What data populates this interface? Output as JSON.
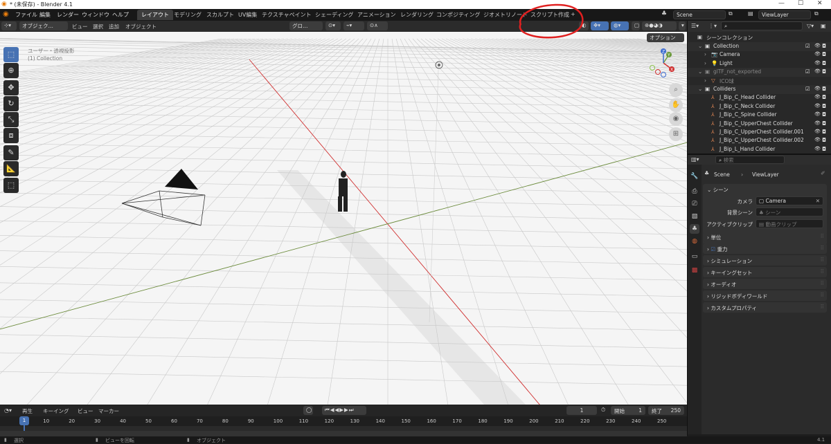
{
  "titlebar": {
    "title": "* (未保存) - Blender 4.1",
    "minimize": "—",
    "maximize": "☐",
    "close": "✕"
  },
  "menu": [
    "ファイル",
    "編集",
    "レンダー",
    "ウィンドウ",
    "ヘルプ"
  ],
  "workspaces": [
    "レイアウト",
    "モデリング",
    "スカルプト",
    "UV編集",
    "テクスチャペイント",
    "シェーディング",
    "アニメーション",
    "レンダリング",
    "コンポジティング",
    "ジオメトリノード",
    "スクリプト作成",
    "+"
  ],
  "active_workspace": 0,
  "scene": {
    "label": "Scene",
    "viewlayer": "ViewLayer"
  },
  "viewport_header": {
    "mode": "オブジェク…",
    "menus": [
      "ビュー",
      "選択",
      "追加",
      "オブジェクト"
    ],
    "transform": "グロ…",
    "options": "オプション"
  },
  "viewport": {
    "view_name": "ユーザー・透視投影",
    "collection": "(1) Collection",
    "gizmo_axes": [
      "X",
      "Y",
      "Z"
    ]
  },
  "outliner": {
    "root": "シーンコレクション",
    "rows": [
      {
        "label": "Collection",
        "indent": 1,
        "type": "collection"
      },
      {
        "label": "Camera",
        "indent": 2,
        "type": "camera"
      },
      {
        "label": "Light",
        "indent": 2,
        "type": "light"
      },
      {
        "label": "glTF_not_exported",
        "indent": 1,
        "type": "collection-dim"
      },
      {
        "label": "ICO球",
        "indent": 2,
        "type": "mesh-dim"
      },
      {
        "label": "Colliders",
        "indent": 1,
        "type": "collection"
      },
      {
        "label": "J_Bip_C_Head Collider",
        "indent": 2,
        "type": "empty"
      },
      {
        "label": "J_Bip_C_Neck Collider",
        "indent": 2,
        "type": "empty"
      },
      {
        "label": "J_Bip_C_Spine Collider",
        "indent": 2,
        "type": "empty"
      },
      {
        "label": "J_Bip_C_UpperChest Collider",
        "indent": 2,
        "type": "empty"
      },
      {
        "label": "J_Bip_C_UpperChest Collider.001",
        "indent": 2,
        "type": "empty"
      },
      {
        "label": "J_Bip_C_UpperChest Collider.002",
        "indent": 2,
        "type": "empty"
      },
      {
        "label": "J_Bip_L_Hand Collider",
        "indent": 2,
        "type": "empty"
      }
    ]
  },
  "properties": {
    "search_placeholder": "検索",
    "breadcrumb": [
      "Scene",
      "ViewLayer"
    ],
    "section": "シーン",
    "fields": [
      {
        "label": "カメラ",
        "value": "Camera"
      },
      {
        "label": "背景シーン",
        "value": "シーン"
      },
      {
        "label": "アクティブクリップ",
        "value": "動画クリップ"
      }
    ],
    "panels": [
      "単位",
      "重力",
      "シミュレーション",
      "キーイングセット",
      "オーディオ",
      "リジッドボディワールド",
      "カスタムプロパティ"
    ]
  },
  "timeline": {
    "menus": [
      "再生",
      "キーイング",
      "ビュー",
      "マーカー"
    ],
    "current_frame": "1",
    "start_label": "開始",
    "start": "1",
    "end_label": "終了",
    "end": "250",
    "ticks": [
      "1",
      "10",
      "20",
      "30",
      "40",
      "50",
      "60",
      "70",
      "80",
      "90",
      "100",
      "110",
      "120",
      "130",
      "140",
      "150",
      "160",
      "170",
      "180",
      "190",
      "200",
      "210",
      "220",
      "230",
      "240",
      "250"
    ]
  },
  "status": {
    "left": "選択",
    "mid": "ビューを回転",
    "right": "オブジェクト",
    "version": "4.1"
  },
  "colors": {
    "accent": "#4772b3",
    "annotation": "#e02020",
    "camera": "#e88a55",
    "axis_x": "#d03030",
    "axis_y": "#6a8a3a"
  }
}
